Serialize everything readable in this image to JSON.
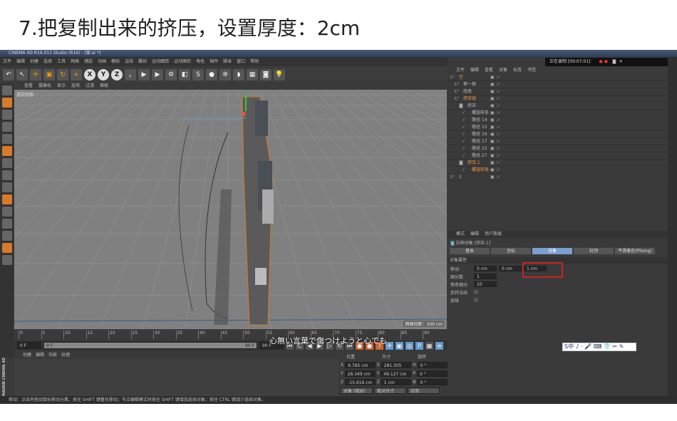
{
  "heading": "7.把复制出来的挤压，设置厚度：2cm",
  "window_title": "CINEMA 4D R16.011 Studio (R16) - [源.ai *]",
  "recording": "正在录制 [00:07:01]",
  "menu": [
    "文件",
    "编辑",
    "创建",
    "选择",
    "工具",
    "网格",
    "捕捉",
    "动画",
    "模拟",
    "渲染",
    "雕刻",
    "运动跟踪",
    "运动图形",
    "角色",
    "插件",
    "脚本",
    "窗口",
    "帮助"
  ],
  "toolbar_icons": [
    "undo-icon",
    "select-icon",
    "move-icon",
    "scale-icon",
    "rotate-icon",
    "add-icon",
    "x-axis-icon",
    "y-axis-icon",
    "z-axis-icon",
    "coord-icon",
    "render-icon",
    "render-view-icon",
    "render-settings-icon",
    "cube-icon",
    "spline-icon",
    "nurbs-icon",
    "array-icon",
    "deformer-icon",
    "floor-icon",
    "camera-icon",
    "light-icon"
  ],
  "axes": [
    "X",
    "Y",
    "Z"
  ],
  "viewport": {
    "menu": [
      "查看",
      "摄像机",
      "显示",
      "选项",
      "过滤",
      "面板"
    ],
    "label": "透视视图",
    "grid": "网格间距：100 cm"
  },
  "timeline": {
    "ticks": [
      "0",
      "5",
      "10",
      "15",
      "20",
      "25",
      "30",
      "35",
      "40",
      "45",
      "50",
      "55",
      "60",
      "65",
      "70",
      "75",
      "80",
      "85",
      "90"
    ],
    "current": "0 F",
    "start": "0 F",
    "end": "90 F",
    "range_end": "90 F",
    "range_start": "0 F"
  },
  "material": {
    "menu": [
      "创建",
      "编辑",
      "功能",
      "纹理"
    ],
    "brand": "MAXON CINEMA 4D"
  },
  "coords": {
    "headers": [
      "位置",
      "尺寸",
      "旋转"
    ],
    "rows": [
      {
        "a": "X",
        "pos": "9.765 cm",
        "b": "X",
        "size": "281.305 cm",
        "c": "H",
        "rot": "0 °"
      },
      {
        "a": "Y",
        "pos": "28.349 cm",
        "b": "Y",
        "size": "49.127 cm",
        "c": "P",
        "rot": "0 °"
      },
      {
        "a": "Z",
        "pos": "-15.616 cm",
        "b": "Z",
        "size": "1 cm",
        "c": "B",
        "rot": "0 °"
      }
    ],
    "mode": "对象 (相对)",
    "size_mode": "绝对尺寸",
    "apply": "应用"
  },
  "subtitle": "心無い言葉で傷つけようと心でも",
  "status": "移动：点击并拖动鼠标移动元素。按住 SHIFT 键量化移动；节点编辑模式时按住 SHIFT 键增加选择对象；按住 CTRL 键减少选择对象。",
  "ime": "S中 ♪ · 🎤 ⌨ 👕 ✂ ✎",
  "objects": {
    "menu": [
      "文件",
      "编辑",
      "查看",
      "对象",
      "标签",
      "书签"
    ],
    "items": [
      {
        "name": "空",
        "depth": 0,
        "orange": true
      },
      {
        "name": "第一根",
        "depth": 1
      },
      {
        "name": "底座",
        "depth": 1
      },
      {
        "name": "挤压组",
        "depth": 1,
        "orange": true
      },
      {
        "name": "挤压",
        "depth": 2
      },
      {
        "name": "螺旋样条",
        "depth": 3
      },
      {
        "name": "路径 14",
        "depth": 3
      },
      {
        "name": "路径 15",
        "depth": 3
      },
      {
        "name": "路径 16",
        "depth": 3
      },
      {
        "name": "路径 17",
        "depth": 3
      },
      {
        "name": "路径 22",
        "depth": 3
      },
      {
        "name": "路径 27",
        "depth": 3
      },
      {
        "name": "挤压.1",
        "depth": 2,
        "orange": true
      },
      {
        "name": "螺旋样条",
        "depth": 3,
        "orange": true
      },
      {
        "name": "1",
        "depth": 0
      }
    ]
  },
  "attributes": {
    "menu": [
      "模式",
      "编辑",
      "用户数据"
    ],
    "object": "拉伸对象 [挤压.1]",
    "tabs": [
      "基本",
      "坐标",
      "对象",
      "封顶",
      "平滑着色(Phong)"
    ],
    "active_tab": "对象",
    "section": "对象属性",
    "move_label": "移动",
    "move": [
      "0 cm",
      "0 cm",
      "1 cm"
    ],
    "subdiv_label": "细分数",
    "subdiv": "1",
    "iso_label": "等参细分",
    "iso": "10",
    "flip_label": "反转法线",
    "flip": false,
    "hier_label": "层级",
    "hier": false
  }
}
